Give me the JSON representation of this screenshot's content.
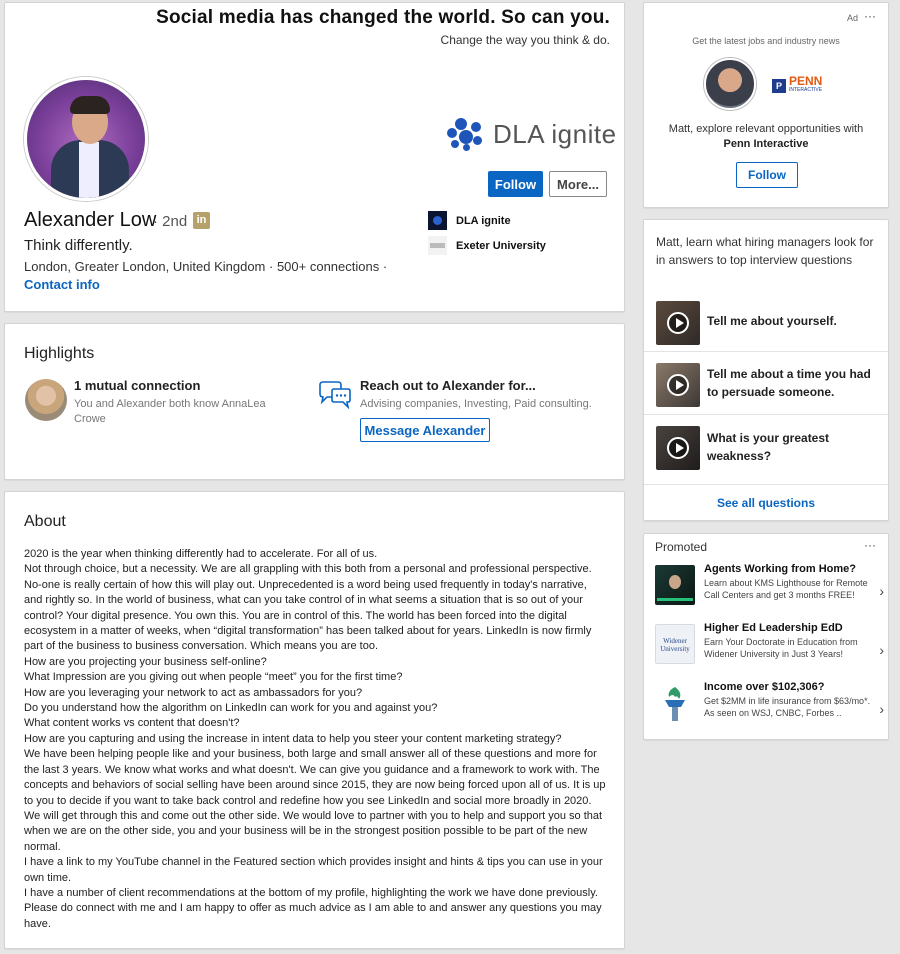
{
  "banner": {
    "title": "Social media has changed the world. So can you.",
    "subtitle": "Change the way you think & do."
  },
  "profile": {
    "company_logo_text": "DLA ignite",
    "follow_label": "Follow",
    "more_label": "More...",
    "name": "Alexander Low",
    "degree": "· 2nd",
    "linkedin_badge": "in",
    "headline": "Think differently.",
    "location": "London, Greater London, United Kingdom  ·  500+ connections  ·",
    "contact_label": "Contact info",
    "orgs": [
      {
        "name": "DLA ignite",
        "icon": "dla-ignite-logo"
      },
      {
        "name": "Exeter University",
        "icon": "exeter-logo"
      }
    ]
  },
  "highlights": {
    "title": "Highlights",
    "mutual_title": "1 mutual connection",
    "mutual_desc": "You and Alexander both know AnnaLea Crowe",
    "reach_title": "Reach out to Alexander for...",
    "reach_desc": "Advising companies, Investing, Paid consulting.",
    "message_label": "Message Alexander"
  },
  "about": {
    "title": "About",
    "lines": [
      "2020 is the year when thinking differently had to accelerate. For all of us.",
      "Not through choice, but a necessity. We are all grappling with this both from a personal and professional perspective. No-one is really certain of how this will play out. Unprecedented is a word being used frequently in today's narrative, and rightly so. In the world of business, what can you take control of in what seems a situation that is so out of your control? Your digital presence. You own this. You are in control of this. The world has been forced into the digital ecosystem in a matter of weeks, when “digital transformation” has been talked about for years. LinkedIn is now firmly part of the business to business conversation. Which means you are too.",
      "How are you projecting your business self-online?",
      "What Impression are you giving out when people “meet” you for the first time?",
      "How are you leveraging your network to act as ambassadors for you?",
      "Do you understand how the algorithm on LinkedIn can work for you and against you?",
      "What content works vs content that doesn't?",
      "How are you capturing and using the increase in intent data to help you steer your content marketing strategy?",
      "We have been helping people like and your business, both large and small answer all of these questions and more for the last 3 years. We know what works and what doesn't. We can give you guidance and a framework to work with. The concepts and behaviors of social selling have been around since 2015, they are now being forced upon all of us. It is up to you to decide if you want to take back control and redefine how you see LinkedIn and social more broadly in 2020.",
      "We will get through this and come out the other side. We would love to partner with you to help and support you so that when we are on the other side, you and your business will be in the strongest position possible to be part of the new normal.",
      "I have a link to my YouTube channel in the Featured section which provides insight and hints & tips you can use in your own time.",
      "I have a number of client recommendations at the bottom of my profile, highlighting the work we have done previously. Please do connect with me and I am happy to offer as much advice as I am able to and answer any questions you may have."
    ]
  },
  "ad": {
    "label": "Ad",
    "menu": "···",
    "tagline": "Get the latest jobs and industry news",
    "company_logo": "PENN",
    "company_logo_sub": "INTERACTIVE",
    "text": "Matt, explore relevant opportunities with",
    "company": "Penn Interactive",
    "follow_label": "Follow"
  },
  "questions": {
    "intro": "Matt, learn what hiring managers look for in answers to top interview questions",
    "items": [
      "Tell me about yourself.",
      "Tell me about a time you had to persuade someone.",
      "What is your greatest weakness?"
    ],
    "see_all": "See all questions"
  },
  "promoted": {
    "title": "Promoted",
    "menu": "···",
    "items": [
      {
        "title": "Agents Working from Home?",
        "desc": "Learn about KMS Lighthouse for Remote Call Centers and get 3 months FREE!"
      },
      {
        "title": "Higher Ed Leadership EdD",
        "desc": "Earn Your Doctorate in Education from Widener University in Just 3 Years!",
        "logo": "Widener University"
      },
      {
        "title": "Income over $102,306?",
        "desc": "Get $2MM in life insurance from $63/mo*. As seen on WSJ, CNBC, Forbes .."
      }
    ],
    "chevron": "›"
  }
}
